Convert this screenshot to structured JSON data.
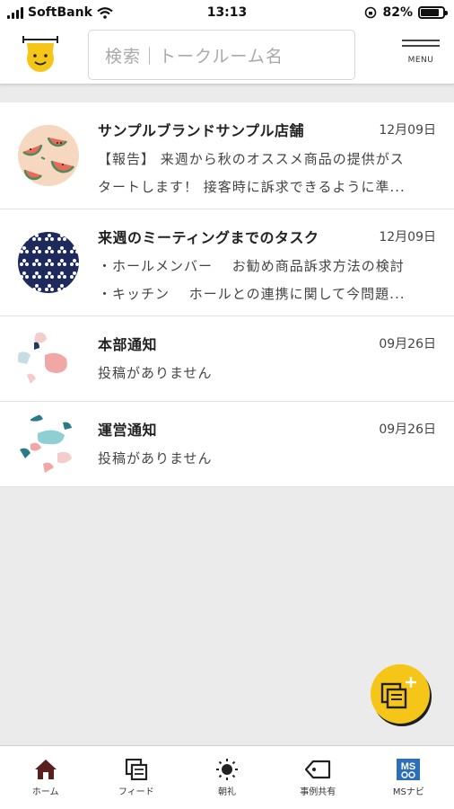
{
  "status_bar": {
    "carrier": "SoftBank",
    "time": "13:13",
    "battery": "82%",
    "battery_level": 0.82
  },
  "header": {
    "search_placeholder": "検索｜トークルーム名",
    "menu_label": "MENU"
  },
  "rooms": [
    {
      "name": "サンプルブランドサンプル店舗",
      "date": "12月09日",
      "lines": [
        "【報告】 来週から秋のオススメ商品の提供がス",
        "タートします！ 接客時に訴求できるように準..."
      ]
    },
    {
      "name": "来週のミーティングまでのタスク",
      "date": "12月09日",
      "lines": [
        "・ホールメンバー　 お勧め商品訴求方法の検討",
        "・キッチン　 ホールとの連携に関して今問題..."
      ]
    },
    {
      "name": "本部通知",
      "date": "09月26日",
      "lines": [
        "投稿がありません"
      ]
    },
    {
      "name": "運営通知",
      "date": "09月26日",
      "lines": [
        "投稿がありません"
      ]
    }
  ],
  "nav": [
    {
      "label": "ホーム",
      "icon": "home-icon"
    },
    {
      "label": "フィード",
      "icon": "feed-icon"
    },
    {
      "label": "朝礼",
      "icon": "sun-icon"
    },
    {
      "label": "事例共有",
      "icon": "tag-icon"
    },
    {
      "label": "MSナビ",
      "icon": "ms-navi-icon"
    }
  ],
  "ms_badge": "MS",
  "colors": {
    "accent": "#f5c518",
    "nav_active": "#5a1f1f",
    "background": "#ebebeb"
  }
}
